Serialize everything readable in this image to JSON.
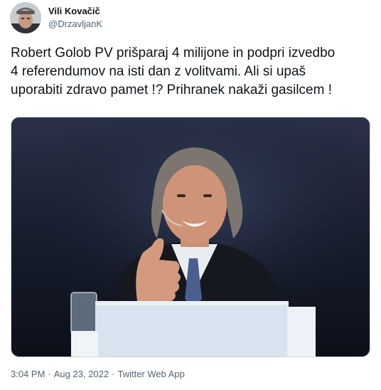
{
  "author": {
    "display_name": "Vili Kovačič",
    "handle": "@DrzavljanK"
  },
  "tweet": {
    "text": "Robert Golob PV prišparaj 4 milijone in podpri izvedbo\n4 referendumov na isti dan z volitvami. Ali si upaš\nuporabiti zdravo pamet !? Prihranek nakaži gasilcem !"
  },
  "meta": {
    "time": "3:04 PM",
    "separator": "·",
    "date": "Aug 23, 2022",
    "source": "Twitter Web App"
  },
  "colors": {
    "text_primary": "#0f1419",
    "text_secondary": "#536471",
    "border": "#cfd9de"
  },
  "icons": {
    "avatar": "user-photo",
    "media": "photo-man-thumbs-up-at-podium"
  }
}
